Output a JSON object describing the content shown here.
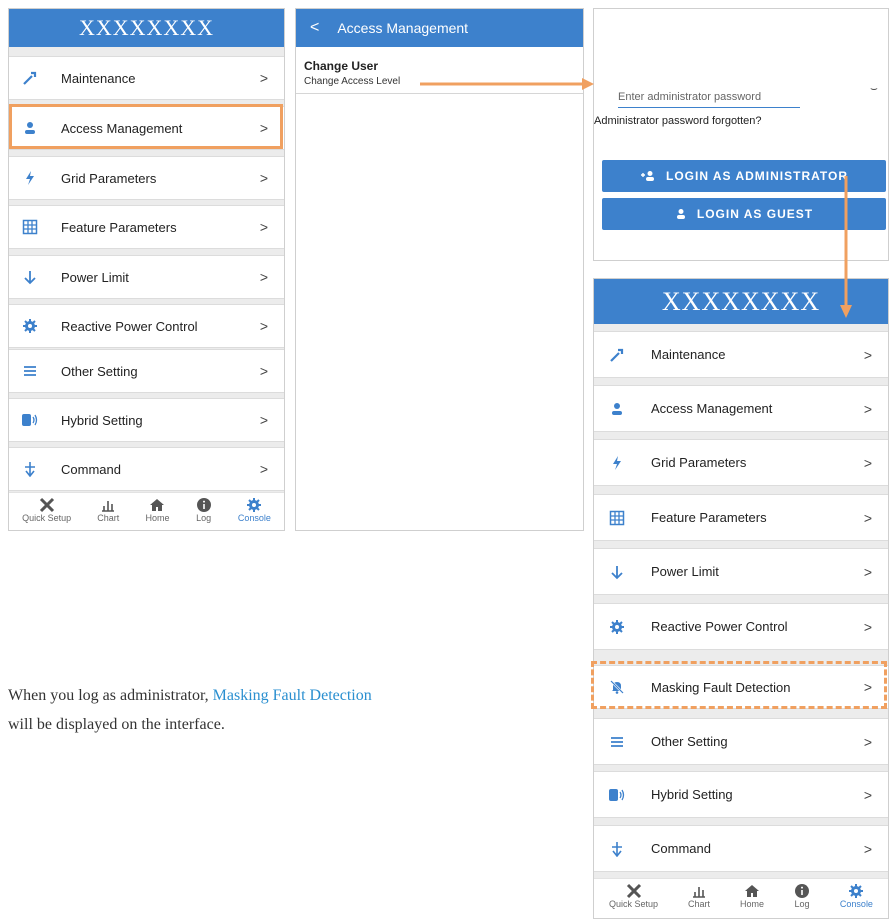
{
  "left_panel": {
    "header_title": "XXXXXXXX",
    "menu": [
      {
        "label": "Maintenance",
        "icon": "wrench-icon"
      },
      {
        "label": "Access Management",
        "icon": "user-icon"
      },
      {
        "label": "Grid Parameters",
        "icon": "bolt-icon"
      },
      {
        "label": "Feature Parameters",
        "icon": "grid-icon"
      },
      {
        "label": "Power Limit",
        "icon": "arrow-down-icon"
      },
      {
        "label": "Reactive Power Control",
        "icon": "gear-icon"
      },
      {
        "label": "Other Setting",
        "icon": "menu-icon"
      },
      {
        "label": "Hybrid Setting",
        "icon": "battery-icon"
      },
      {
        "label": "Command",
        "icon": "command-icon"
      }
    ],
    "chevron": ">"
  },
  "bottom_nav": [
    {
      "label": "Quick Setup",
      "icon": "tools-icon"
    },
    {
      "label": "Chart",
      "icon": "chart-icon"
    },
    {
      "label": "Home",
      "icon": "home-icon"
    },
    {
      "label": "Log",
      "icon": "info-icon"
    },
    {
      "label": "Console",
      "icon": "gear-icon",
      "active": true
    }
  ],
  "middle_panel": {
    "back": "<",
    "title": "Access Management",
    "item_title": "Change User",
    "item_subtitle": "Change Access Level"
  },
  "login_panel": {
    "password_placeholder": "Enter administrator password",
    "forgot": "Administrator password forgotten?",
    "admin_button": "LOGIN AS ADMINISTRATOR",
    "guest_button": "LOGIN AS GUEST"
  },
  "right_panel": {
    "header_title": "XXXXXXXX",
    "menu": [
      {
        "label": "Maintenance",
        "icon": "wrench-icon"
      },
      {
        "label": "Access Management",
        "icon": "user-icon"
      },
      {
        "label": "Grid Parameters",
        "icon": "bolt-icon"
      },
      {
        "label": "Feature Parameters",
        "icon": "grid-icon"
      },
      {
        "label": "Power Limit",
        "icon": "arrow-down-icon"
      },
      {
        "label": "Reactive Power Control",
        "icon": "gear-icon"
      },
      {
        "label": "Masking Fault Detection",
        "icon": "bell-off-icon"
      },
      {
        "label": "Other Setting",
        "icon": "menu-icon"
      },
      {
        "label": "Hybrid Setting",
        "icon": "battery-icon"
      },
      {
        "label": "Command",
        "icon": "command-icon"
      }
    ]
  },
  "caption": {
    "line1_prefix": "When you log as administrator, ",
    "highlight": "Masking Fault Detection",
    "line2": "will be displayed on the interface."
  },
  "colors": {
    "accent": "#3d81cc",
    "highlight": "#f0a060",
    "link": "#2a8fd0"
  }
}
